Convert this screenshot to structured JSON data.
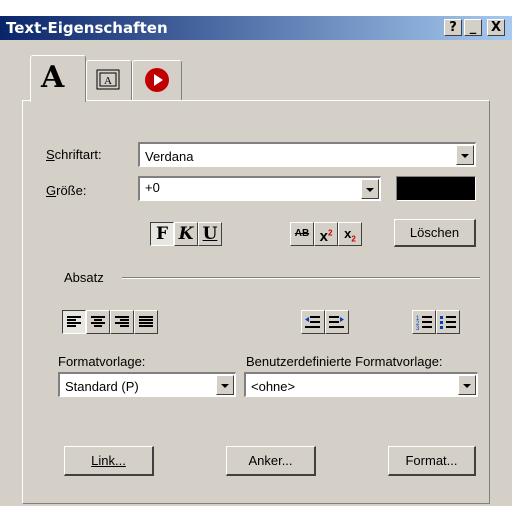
{
  "window": {
    "title": "Text-Eigenschaften",
    "help_label": "?",
    "minimize_label": "_",
    "close_label": "X"
  },
  "tabs": [
    {
      "id": "text",
      "label": "A",
      "icon": "letter-a-icon",
      "active": true
    },
    {
      "id": "frame",
      "icon": "text-frame-icon"
    },
    {
      "id": "action",
      "icon": "record-icon",
      "color": "#c00000"
    }
  ],
  "font": {
    "label": "Schriftart:",
    "value": "Verdana"
  },
  "size": {
    "label": "Größe:",
    "value": "+0",
    "color": "#000000"
  },
  "style_buttons": {
    "bold": "F",
    "italic": "K",
    "underline": "U",
    "strike": "AB",
    "superscript": "x",
    "superscript_mark": "2",
    "subscript": "x",
    "subscript_mark": "2",
    "clear_label": "Löschen"
  },
  "paragraph": {
    "group_label": "Absatz",
    "align_icons": [
      "align-left-icon",
      "align-center-icon",
      "align-right-icon",
      "align-justify-icon"
    ],
    "indent_icons": [
      "outdent-icon",
      "indent-icon"
    ],
    "list_icons": [
      "numbered-list-icon",
      "bulleted-list-icon"
    ]
  },
  "style_template": {
    "label": "Formatvorlage:",
    "value": "Standard (P)"
  },
  "custom_template": {
    "label": "Benutzerdefinierte Formatvorlage:",
    "value": "<ohne>"
  },
  "footer": {
    "link_label": "Link...",
    "anchor_label": "Anker...",
    "format_label": "Format..."
  }
}
